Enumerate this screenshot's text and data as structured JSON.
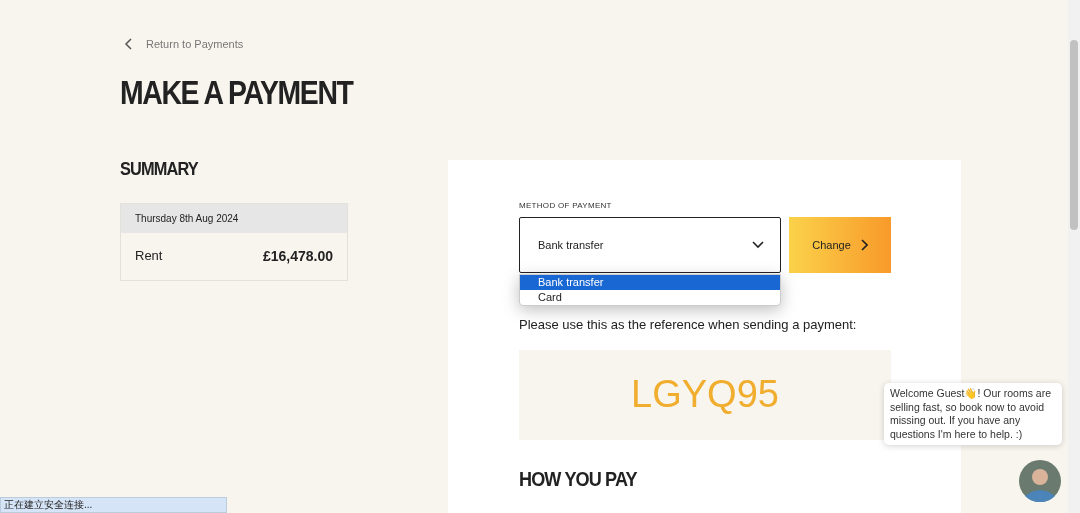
{
  "back_link": {
    "label": "Return to Payments"
  },
  "page_title": "MAKE A PAYMENT",
  "summary": {
    "heading": "SUMMARY",
    "date": "Thursday 8th Aug 2024",
    "items": [
      {
        "label": "Rent",
        "amount": "£16,478.00"
      }
    ]
  },
  "payment": {
    "method_label": "METHOD OF PAYMENT",
    "method_value": "Bank transfer",
    "dropdown_open": true,
    "options": [
      {
        "label": "Bank transfer",
        "selected": true
      },
      {
        "label": "Card",
        "selected": false
      }
    ],
    "change_button": "Change",
    "reference_hint": "Please use this as the reference when sending a payment:",
    "reference_code": "LGYQ95",
    "how_heading": "HOW YOU PAY"
  },
  "chat": {
    "message": "Welcome Guest👋! Our rooms are selling fast, so book now to avoid missing out. If you have any questions I'm here to help. :)"
  },
  "status_bar": "正在建立安全连接..."
}
